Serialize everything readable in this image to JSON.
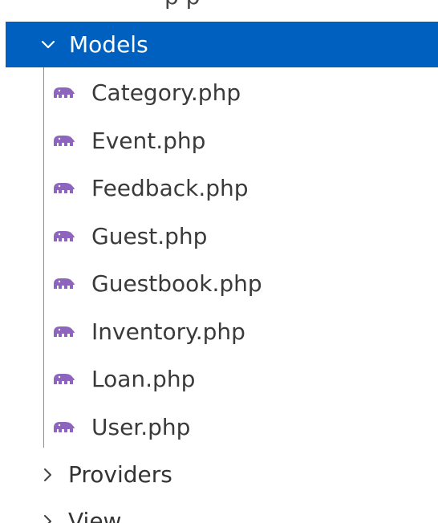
{
  "explorer": {
    "partial_top_label": "p p",
    "models_folder": {
      "label": "Models",
      "state_icon": "chevron-down-icon"
    },
    "files": [
      {
        "name": "Category.php",
        "icon": "php-elephant-icon"
      },
      {
        "name": "Event.php",
        "icon": "php-elephant-icon"
      },
      {
        "name": "Feedback.php",
        "icon": "php-elephant-icon"
      },
      {
        "name": "Guest.php",
        "icon": "php-elephant-icon"
      },
      {
        "name": "Guestbook.php",
        "icon": "php-elephant-icon"
      },
      {
        "name": "Inventory.php",
        "icon": "php-elephant-icon"
      },
      {
        "name": "Loan.php",
        "icon": "php-elephant-icon"
      },
      {
        "name": "User.php",
        "icon": "php-elephant-icon"
      }
    ],
    "providers_folder": {
      "label": "Providers",
      "state_icon": "chevron-right-icon"
    },
    "view_folder": {
      "label": "View",
      "state_icon": "chevron-right-icon"
    }
  },
  "colors": {
    "selection": "#0060c0",
    "php_icon": "#8d65bf",
    "text": "#3a3a3a"
  }
}
